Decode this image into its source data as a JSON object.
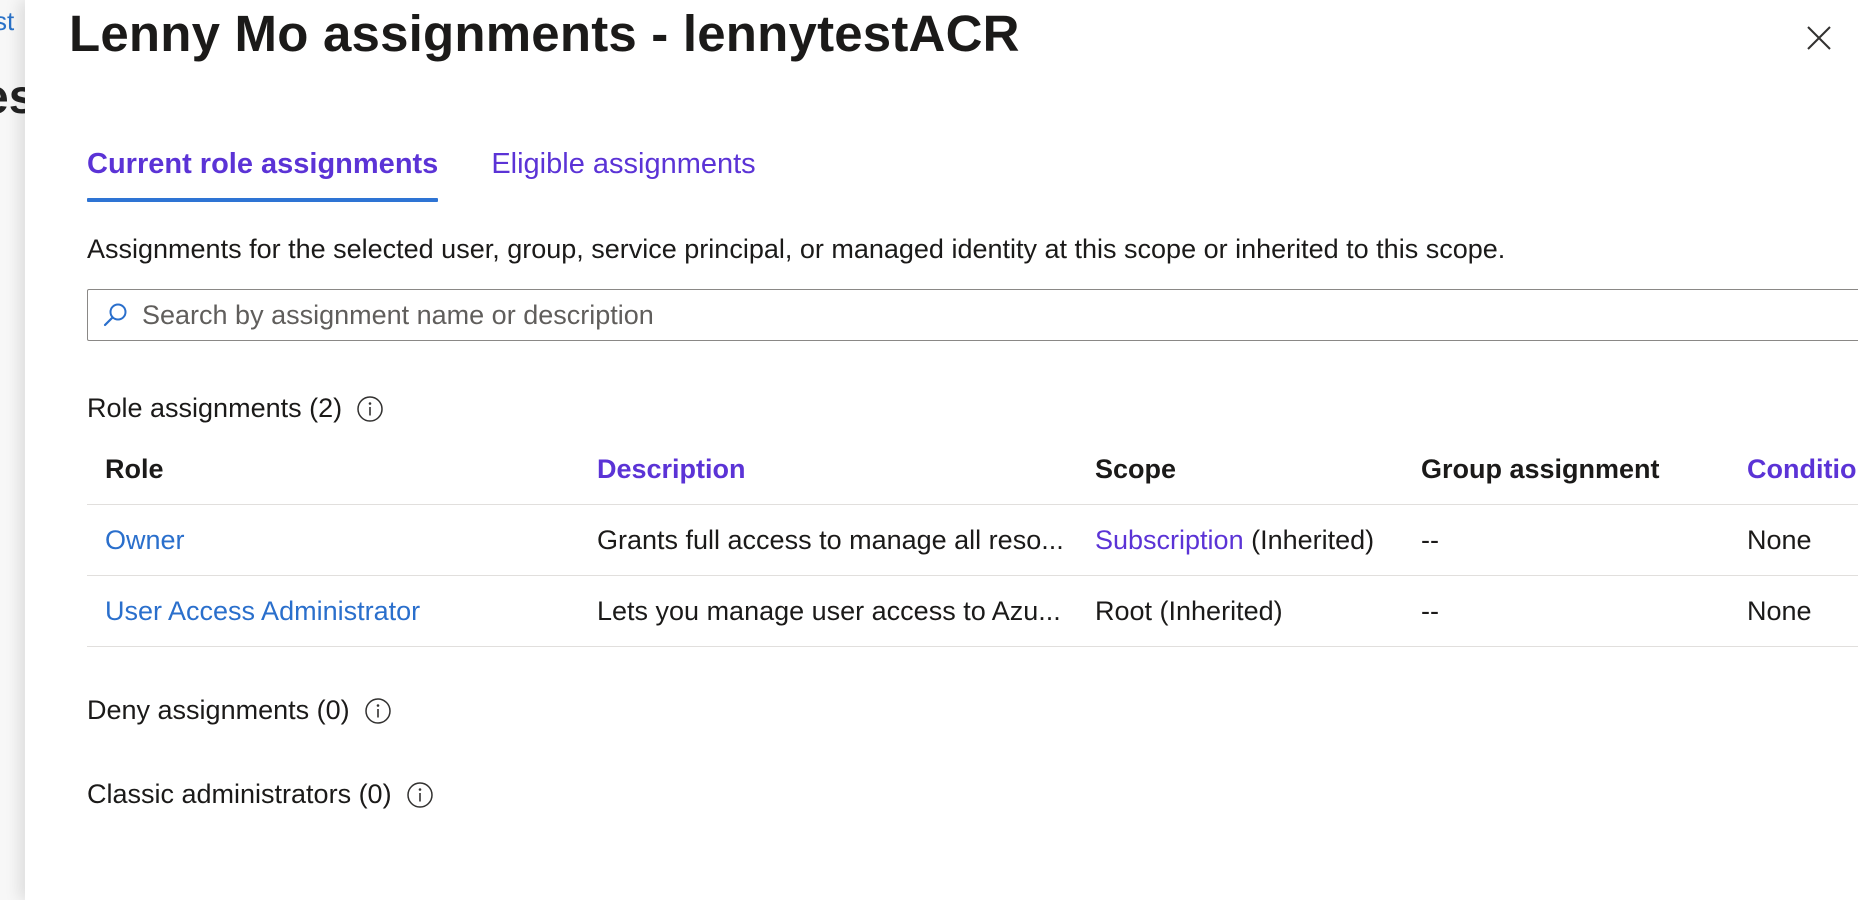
{
  "background_page": {
    "link_fragment": "st",
    "title_fragment": "es"
  },
  "blade": {
    "title": "Lenny Mo assignments - lennytestACR",
    "close_icon": "close-icon"
  },
  "tabs": [
    {
      "label": "Current role assignments",
      "active": true
    },
    {
      "label": "Eligible assignments",
      "active": false
    }
  ],
  "intro_text": "Assignments for the selected user, group, service principal, or managed identity at this scope or inherited to this scope.",
  "search": {
    "placeholder": "Search by assignment name or description",
    "value": "",
    "icon": "search-icon"
  },
  "role_assignments": {
    "heading": "Role assignments (2)",
    "columns": {
      "role": "Role",
      "description": "Description",
      "scope": "Scope",
      "group": "Group assignment",
      "condition": "Conditio"
    },
    "rows": [
      {
        "role": "Owner",
        "description": "Grants full access to manage all reso...",
        "scope_link": "Subscription",
        "scope_suffix": " (Inherited)",
        "group": "--",
        "condition": "None"
      },
      {
        "role": "User Access Administrator",
        "description": "Lets you manage user access to Azu...",
        "scope_link": "",
        "scope_suffix": "Root (Inherited)",
        "group": "--",
        "condition": "None"
      }
    ]
  },
  "deny_assignments": {
    "heading": "Deny assignments (0)"
  },
  "classic_administrators": {
    "heading": "Classic administrators (0)"
  },
  "colors": {
    "link_blue": "#2a6fcc",
    "accent_purple": "#5b33d6",
    "tab_underline": "#2e74d4",
    "text": "#1b1a19",
    "border": "#e1dfdd"
  }
}
